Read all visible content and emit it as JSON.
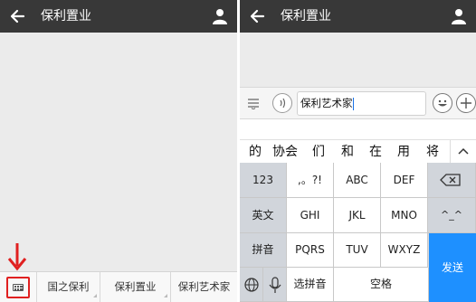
{
  "left": {
    "title": "保利置业",
    "menu_items": [
      "国之保利",
      "保利置业",
      "保利艺术家"
    ]
  },
  "right": {
    "title": "保利置业",
    "input_value": "保利艺术家",
    "candidates": [
      "的",
      "协会",
      "们",
      "和",
      "在",
      "用",
      "将"
    ],
    "keys": {
      "k123": "123",
      "punct": ",。?!",
      "abc": "ABC",
      "def": "DEF",
      "english": "英文",
      "ghi": "GHI",
      "jkl": "JKL",
      "mno": "MNO",
      "emoticon": "^_^",
      "pinyin": "拼音",
      "pqrs": "PQRS",
      "tuv": "TUV",
      "wxyz": "WXYZ",
      "send": "发送",
      "select_pinyin": "选拼音",
      "space": "空格"
    }
  },
  "colors": {
    "navbar": "#383838",
    "accent_red": "#e02020",
    "send_blue": "#1e90ff"
  },
  "icons": [
    "back-arrow-icon",
    "user-icon",
    "keyboard-icon",
    "menu-list-icon",
    "voice-icon",
    "emoji-icon",
    "add-icon",
    "backspace-icon",
    "globe-icon",
    "microphone-icon",
    "chevron-up-icon"
  ]
}
